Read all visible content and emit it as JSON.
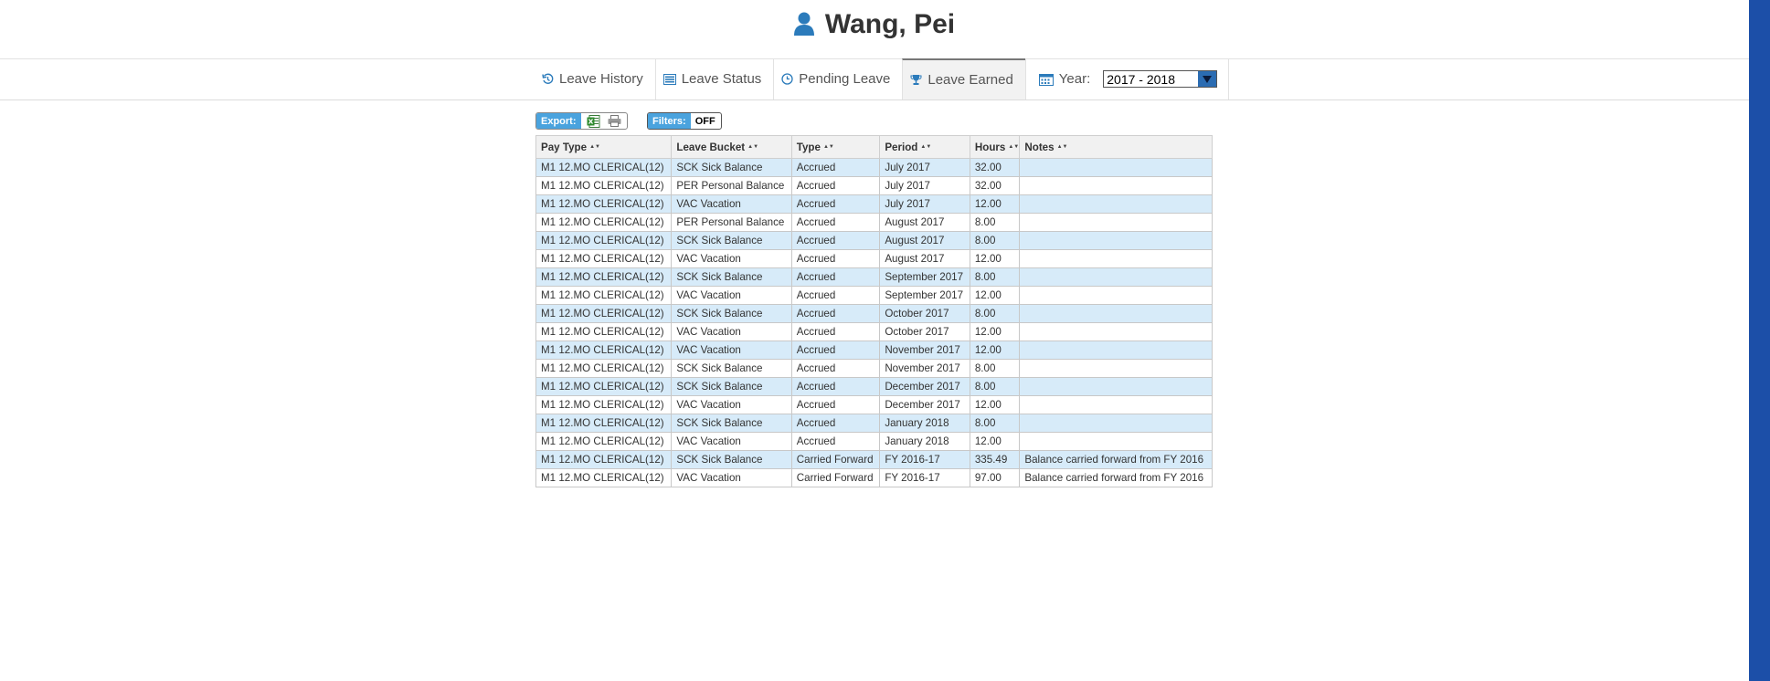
{
  "title": "Wang, Pei",
  "tabs": [
    {
      "label": "Leave History"
    },
    {
      "label": "Leave Status"
    },
    {
      "label": "Pending Leave"
    },
    {
      "label": "Leave Earned",
      "active": true
    }
  ],
  "year": {
    "label": "Year:",
    "value": "2017 - 2018"
  },
  "toolbar": {
    "export_label": "Export:",
    "filters_label": "Filters:",
    "filters_state": "OFF"
  },
  "table": {
    "headers": [
      "Pay Type",
      "Leave Bucket",
      "Type",
      "Period",
      "Hours",
      "Notes"
    ],
    "rows": [
      [
        "M1 12.MO CLERICAL(12)",
        "SCK Sick Balance",
        "Accrued",
        "July 2017",
        "32.00",
        ""
      ],
      [
        "M1 12.MO CLERICAL(12)",
        "PER Personal Balance",
        "Accrued",
        "July 2017",
        "32.00",
        ""
      ],
      [
        "M1 12.MO CLERICAL(12)",
        "VAC Vacation",
        "Accrued",
        "July 2017",
        "12.00",
        ""
      ],
      [
        "M1 12.MO CLERICAL(12)",
        "PER Personal Balance",
        "Accrued",
        "August 2017",
        "8.00",
        ""
      ],
      [
        "M1 12.MO CLERICAL(12)",
        "SCK Sick Balance",
        "Accrued",
        "August 2017",
        "8.00",
        ""
      ],
      [
        "M1 12.MO CLERICAL(12)",
        "VAC Vacation",
        "Accrued",
        "August 2017",
        "12.00",
        ""
      ],
      [
        "M1 12.MO CLERICAL(12)",
        "SCK Sick Balance",
        "Accrued",
        "September 2017",
        "8.00",
        ""
      ],
      [
        "M1 12.MO CLERICAL(12)",
        "VAC Vacation",
        "Accrued",
        "September 2017",
        "12.00",
        ""
      ],
      [
        "M1 12.MO CLERICAL(12)",
        "SCK Sick Balance",
        "Accrued",
        "October 2017",
        "8.00",
        ""
      ],
      [
        "M1 12.MO CLERICAL(12)",
        "VAC Vacation",
        "Accrued",
        "October 2017",
        "12.00",
        ""
      ],
      [
        "M1 12.MO CLERICAL(12)",
        "VAC Vacation",
        "Accrued",
        "November 2017",
        "12.00",
        ""
      ],
      [
        "M1 12.MO CLERICAL(12)",
        "SCK Sick Balance",
        "Accrued",
        "November 2017",
        "8.00",
        ""
      ],
      [
        "M1 12.MO CLERICAL(12)",
        "SCK Sick Balance",
        "Accrued",
        "December 2017",
        "8.00",
        ""
      ],
      [
        "M1 12.MO CLERICAL(12)",
        "VAC Vacation",
        "Accrued",
        "December 2017",
        "12.00",
        ""
      ],
      [
        "M1 12.MO CLERICAL(12)",
        "SCK Sick Balance",
        "Accrued",
        "January 2018",
        "8.00",
        ""
      ],
      [
        "M1 12.MO CLERICAL(12)",
        "VAC Vacation",
        "Accrued",
        "January 2018",
        "12.00",
        ""
      ],
      [
        "M1 12.MO CLERICAL(12)",
        "SCK Sick Balance",
        "Carried Forward",
        "FY 2016-17",
        "335.49",
        "Balance carried forward from FY 2016"
      ],
      [
        "M1 12.MO CLERICAL(12)",
        "VAC Vacation",
        "Carried Forward",
        "FY 2016-17",
        "97.00",
        "Balance carried forward from FY 2016"
      ]
    ]
  },
  "colors": {
    "accent": "#2b7bbb",
    "row_alt": "#d7ebf9",
    "label_bg": "#4aa3de",
    "side_bar": "#1c4fa8"
  }
}
